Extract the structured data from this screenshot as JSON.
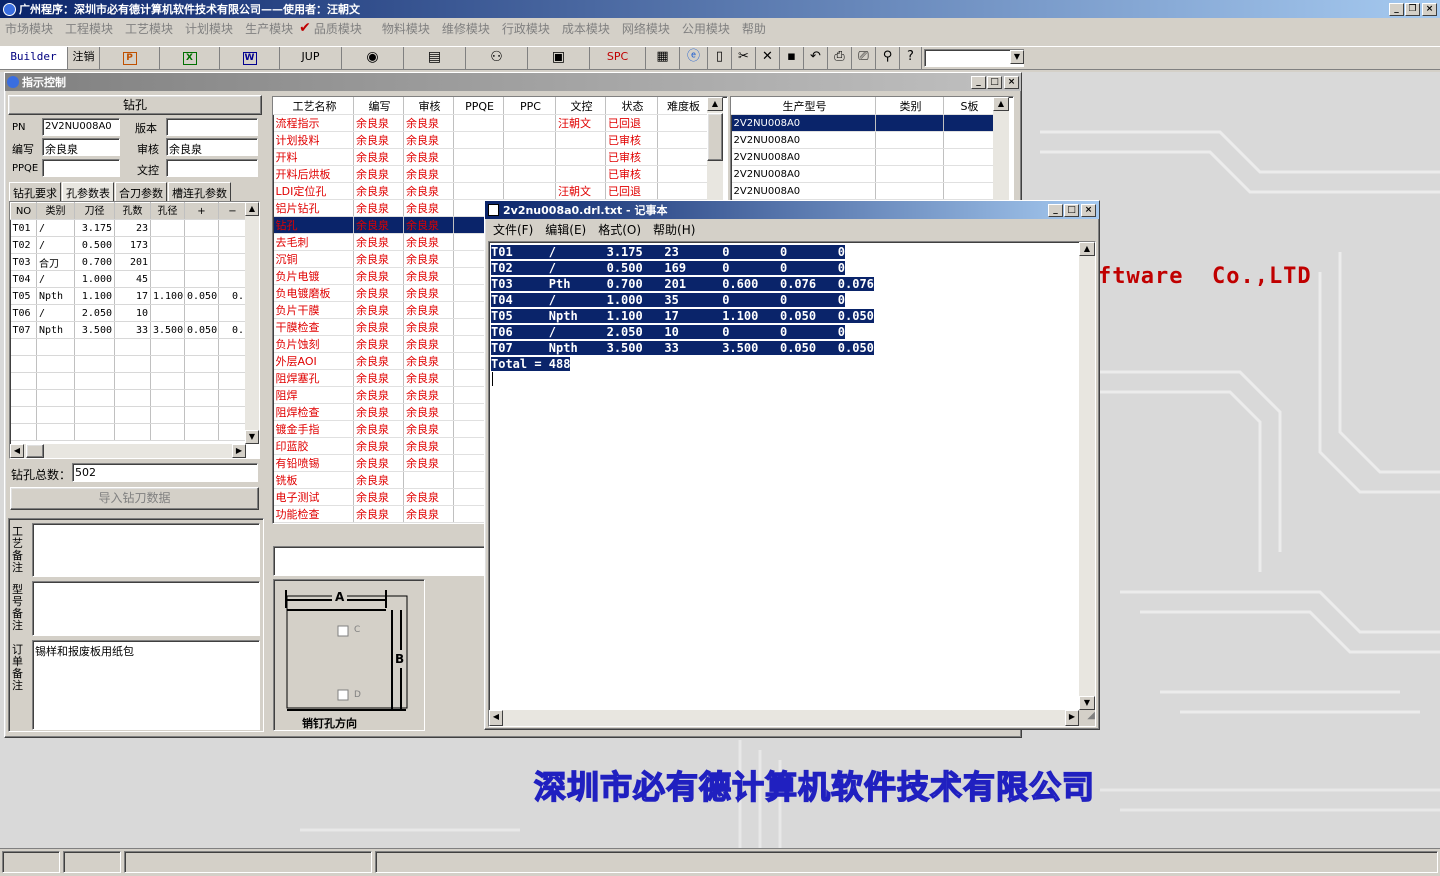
{
  "title_bar": {
    "title": "广州程序：深圳市必有德计算机软件技术有限公司——使用者：汪朝文"
  },
  "menu": [
    "市场模块",
    "工程模块",
    "工艺模块",
    "计划模块",
    "生产模块",
    "品质模块",
    "物料模块",
    "维修模块",
    "行政模块",
    "成本模块",
    "网络模块",
    "公用模块",
    "帮助"
  ],
  "toolbar": {
    "builder": "Builder",
    "logout": "注销",
    "ppt": "P",
    "excel": "X",
    "word": "W",
    "jup": "JUP",
    "spc": "SPC"
  },
  "main_window": {
    "title": "指示控制"
  },
  "left": {
    "section_title": "钻孔",
    "pn_label": "PN",
    "pn_value": "2V2NU008A0",
    "version_label": "版本",
    "version_value": "",
    "author_label": "编写",
    "author_value": "余良泉",
    "review_label": "审核",
    "review_value": "余良泉",
    "ppqe_label": "PPQE",
    "ppqe_value": "",
    "doc_label": "文控",
    "doc_value": "",
    "tabs": [
      "钻孔要求",
      "孔参数表",
      "合刀参数",
      "槽连孔参数"
    ],
    "drill_headers": [
      "NO",
      "类别",
      "刀径",
      "孔数",
      "孔径",
      "+",
      "−"
    ],
    "drill_rows": [
      [
        "T01",
        "/",
        "3.175",
        "23",
        "",
        "",
        ""
      ],
      [
        "T02",
        "/",
        "0.500",
        "173",
        "",
        "",
        ""
      ],
      [
        "T03",
        "合刀",
        "0.700",
        "201",
        "",
        "",
        ""
      ],
      [
        "T04",
        "/",
        "1.000",
        "45",
        "",
        "",
        ""
      ],
      [
        "T05",
        "Npth",
        "1.100",
        "17",
        "1.100",
        "0.050",
        "0."
      ],
      [
        "T06",
        "/",
        "2.050",
        "10",
        "",
        "",
        ""
      ],
      [
        "T07",
        "Npth",
        "3.500",
        "33",
        "3.500",
        "0.050",
        "0."
      ]
    ],
    "total_label": "钻孔总数：",
    "total_value": "502",
    "import_button": "导入钻刀数据",
    "note1_label": "工艺备注",
    "note2_label": "型号备注",
    "note3_label": "订单备注",
    "note3_value": "锡样和报废板用纸包"
  },
  "process": {
    "headers": [
      "工艺名称",
      "编写",
      "审核",
      "PPQE",
      "PPC",
      "文控",
      "状态",
      "难度板"
    ],
    "rows": [
      [
        "流程指示",
        "余良泉",
        "余良泉",
        "",
        "",
        "汪朝文",
        "已回退",
        ""
      ],
      [
        "计划投料",
        "余良泉",
        "余良泉",
        "",
        "",
        "",
        "已审核",
        ""
      ],
      [
        "开料",
        "余良泉",
        "余良泉",
        "",
        "",
        "",
        "已审核",
        ""
      ],
      [
        "开料后烘板",
        "余良泉",
        "余良泉",
        "",
        "",
        "",
        "已审核",
        ""
      ],
      [
        "LDI定位孔",
        "余良泉",
        "余良泉",
        "",
        "",
        "汪朝文",
        "已回退",
        ""
      ],
      [
        "铝片钻孔",
        "余良泉",
        "余良泉",
        "",
        "",
        "",
        "",
        ""
      ],
      [
        "钻孔",
        "余良泉",
        "余良泉",
        "",
        "",
        "",
        "",
        ""
      ],
      [
        "去毛刺",
        "余良泉",
        "余良泉",
        "",
        "",
        "",
        "",
        ""
      ],
      [
        "沉铜",
        "余良泉",
        "余良泉",
        "",
        "",
        "",
        "",
        ""
      ],
      [
        "负片电镀",
        "余良泉",
        "余良泉",
        "",
        "",
        "",
        "",
        ""
      ],
      [
        "负电镀磨板",
        "余良泉",
        "余良泉",
        "",
        "",
        "",
        "",
        ""
      ],
      [
        "负片干膜",
        "余良泉",
        "余良泉",
        "",
        "",
        "",
        "",
        ""
      ],
      [
        "干膜检查",
        "余良泉",
        "余良泉",
        "",
        "",
        "",
        "",
        ""
      ],
      [
        "负片蚀刻",
        "余良泉",
        "余良泉",
        "",
        "",
        "",
        "",
        ""
      ],
      [
        "外层AOI",
        "余良泉",
        "余良泉",
        "",
        "",
        "",
        "",
        ""
      ],
      [
        "阻焊塞孔",
        "余良泉",
        "余良泉",
        "",
        "",
        "",
        "",
        ""
      ],
      [
        "阻焊",
        "余良泉",
        "余良泉",
        "",
        "",
        "",
        "",
        ""
      ],
      [
        "阻焊检查",
        "余良泉",
        "余良泉",
        "",
        "",
        "",
        "",
        ""
      ],
      [
        "镀金手指",
        "余良泉",
        "余良泉",
        "",
        "",
        "",
        "",
        ""
      ],
      [
        "印蓝胶",
        "余良泉",
        "余良泉",
        "",
        "",
        "",
        "",
        ""
      ],
      [
        "有铅喷锡",
        "余良泉",
        "余良泉",
        "",
        "",
        "",
        "",
        ""
      ],
      [
        "铣板",
        "余良泉",
        "",
        "",
        "",
        "",
        "",
        ""
      ],
      [
        "电子测试",
        "余良泉",
        "余良泉",
        "",
        "",
        "",
        "",
        ""
      ],
      [
        "功能检查",
        "余良泉",
        "余良泉",
        "",
        "",
        "",
        "",
        ""
      ]
    ],
    "selected_index": 6
  },
  "model": {
    "headers": [
      "生产型号",
      "类别",
      "S板"
    ],
    "rows": [
      "2V2NU008A0",
      "2V2NU008A0",
      "2V2NU008A0",
      "2V2NU008A0",
      "2V2NU008A0"
    ]
  },
  "pin_diagram": {
    "a": "A",
    "b": "B",
    "c": "C",
    "d": "D",
    "caption": "销钉孔方向"
  },
  "notepad": {
    "title": "2v2nu008a0.drl.txt - 记事本",
    "menu": [
      "文件(F)",
      "编辑(E)",
      "格式(O)",
      "帮助(H)"
    ],
    "lines": [
      "T01     /       3.175   23      0       0       0",
      "T02     /       0.500   169     0       0       0",
      "T03     Pth     0.700   201     0.600   0.076   0.076",
      "T04     /       1.000   35      0       0       0",
      "T05     Npth    1.100   17      1.100   0.050   0.050",
      "T06     /       2.050   10      0       0       0",
      "T07     Npth    3.500   33      3.500   0.050   0.050",
      "Total = 488"
    ]
  },
  "background": {
    "company_en_fragment": "ftware  Co.,LTD",
    "company_cn": "深圳市必有德计算机软件技术有限公司"
  },
  "colors": {
    "title_blue": "#0a246a",
    "red_text": "#e00000",
    "bg_gray": "#d4d0c8"
  }
}
